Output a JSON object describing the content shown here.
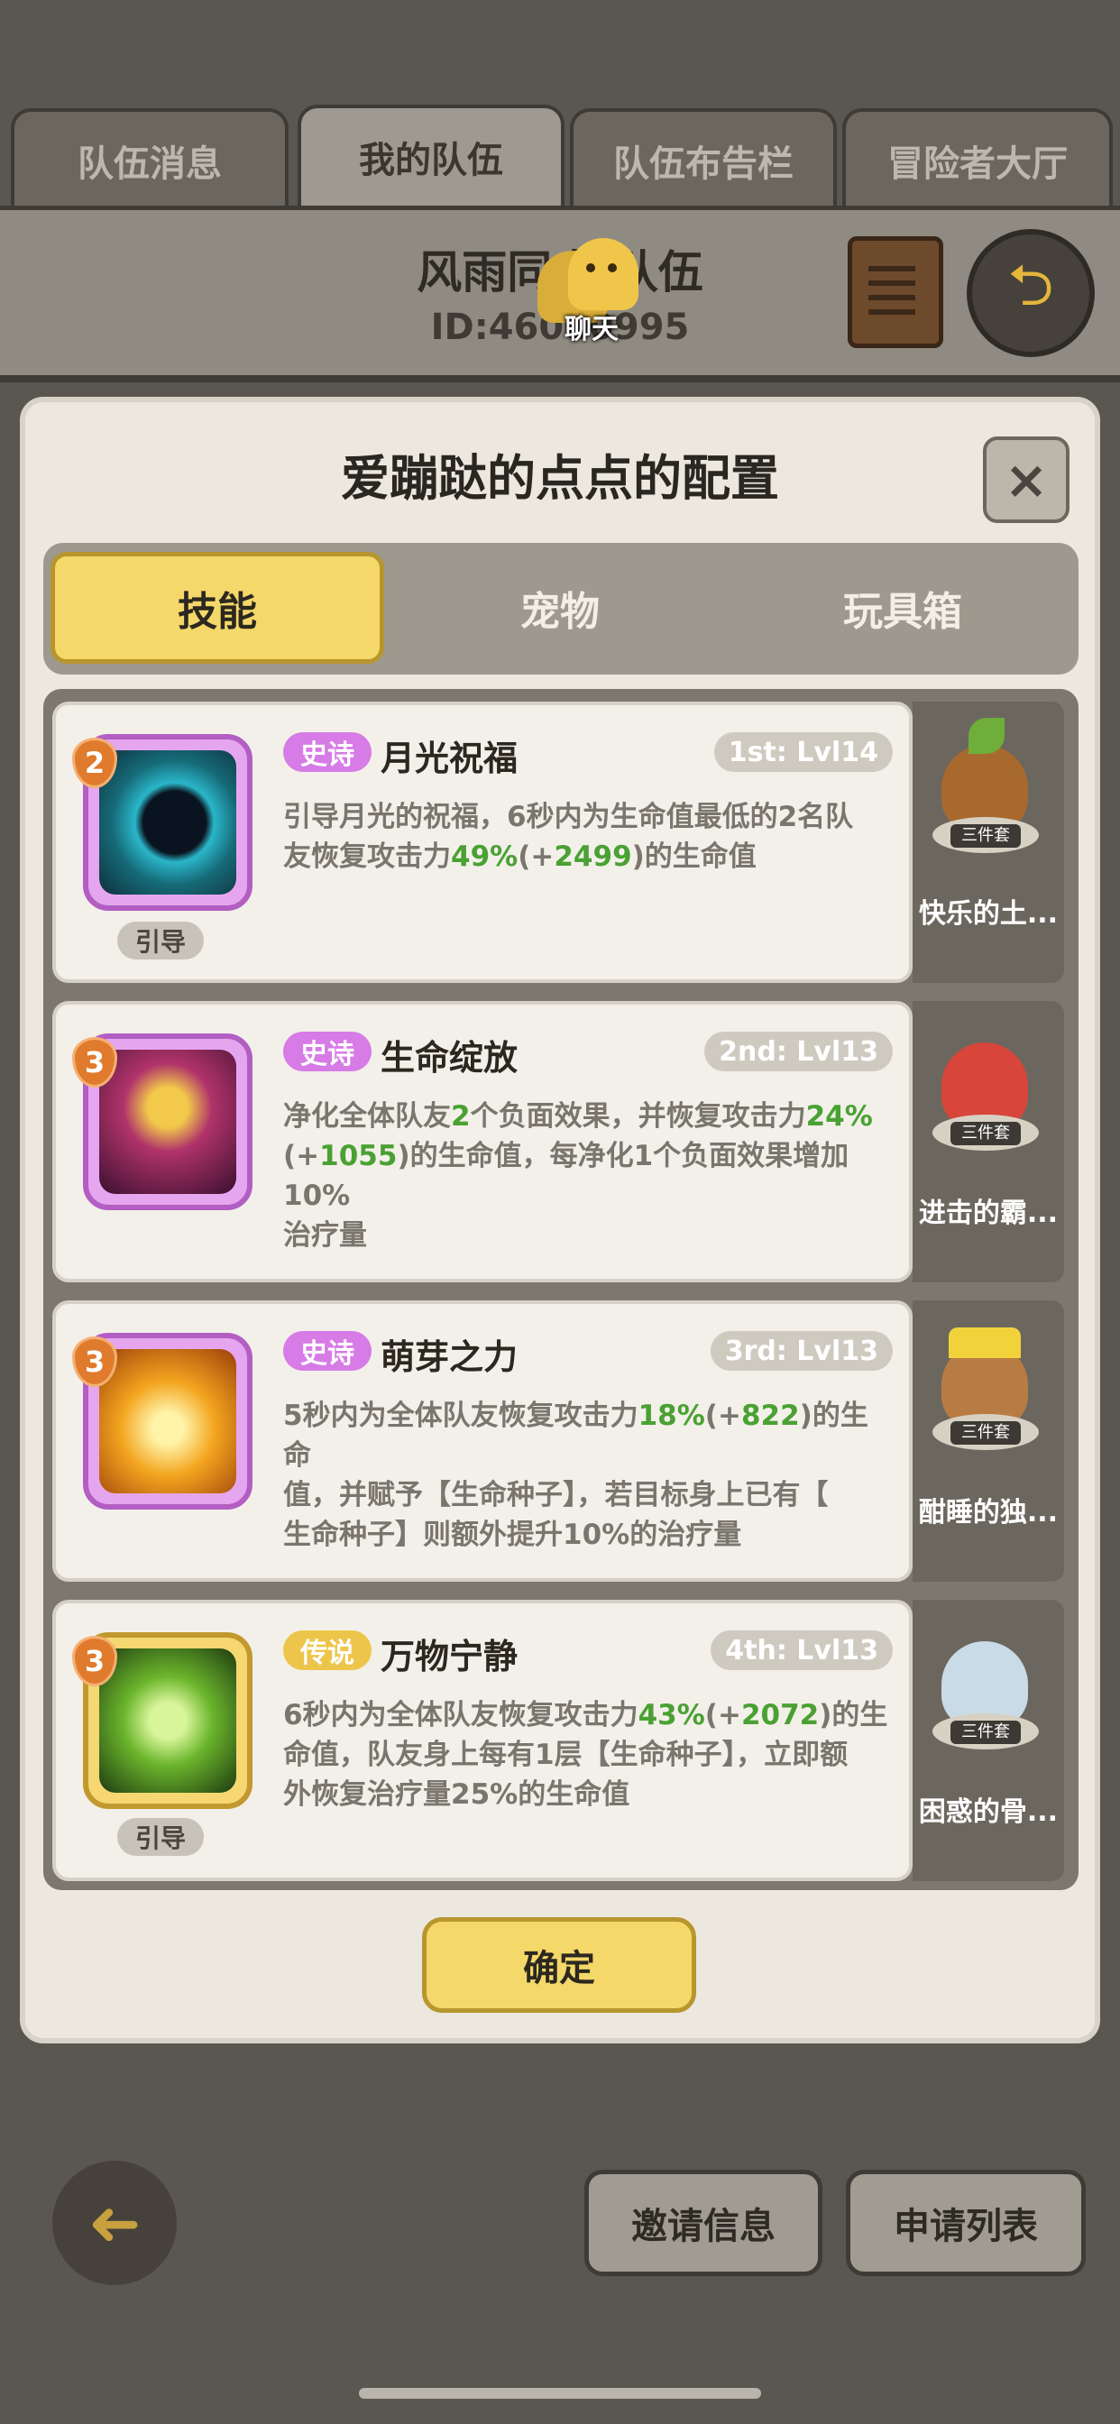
{
  "top_tabs": [
    "队伍消息",
    "我的队伍",
    "队伍布告栏",
    "冒险者大厅"
  ],
  "team": {
    "name": "风雨同舟 队伍",
    "id": "ID:46000995",
    "chat_label": "聊天"
  },
  "dialog": {
    "title": "爱蹦跶的点点的配置",
    "close_icon": "×",
    "tabs": [
      "技能",
      "宠物",
      "玩具箱"
    ],
    "confirm": "确定"
  },
  "skills": [
    {
      "level": "2",
      "rarity": "史诗",
      "name": "月光祝福",
      "rank": "1st: Lvl14",
      "guide": "引导",
      "desc": [
        "引导月光的祝福，6秒内为生命值最低的2名队",
        "友恢复攻击力",
        "49%",
        "(+",
        "2499",
        ")的生命值"
      ],
      "pet": "快乐的土...",
      "pet_tag": "三件套"
    },
    {
      "level": "3",
      "rarity": "史诗",
      "name": "生命绽放",
      "rank": "2nd: Lvl13",
      "guide": "",
      "desc": [
        "净化全体队友",
        "2",
        "个负面效果，并恢复攻击力",
        "24%",
        "(+",
        "1055",
        ")的生命值，每净化1个负面效果增加10%",
        "治疗量"
      ],
      "pet": "进击的霸...",
      "pet_tag": "三件套"
    },
    {
      "level": "3",
      "rarity": "史诗",
      "name": "萌芽之力",
      "rank": "3rd: Lvl13",
      "guide": "",
      "desc": [
        "5秒内为全体队友恢复攻击力",
        "18%",
        "(+",
        "822",
        ")的生命",
        "值，并赋予【生命种子】，若目标身上已有【",
        "生命种子】则额外提升10%的治疗量"
      ],
      "pet": "酣睡的独...",
      "pet_tag": "三件套"
    },
    {
      "level": "3",
      "rarity": "传说",
      "name": "万物宁静",
      "rank": "4th: Lvl13",
      "guide": "引导",
      "desc": [
        "6秒内为全体队友恢复攻击力",
        "43%",
        "(+",
        "2072",
        ")的生",
        "命值，队友身上每有1层【生命种子】，立即额",
        "外恢复治疗量25%的生命值"
      ],
      "pet": "困惑的骨...",
      "pet_tag": "三件套"
    }
  ],
  "bottom": {
    "invite": "邀请信息",
    "apply": "申请列表",
    "back_icon": "arrow-left-icon"
  },
  "colors": {
    "accent_yellow": "#f4d86a",
    "epic": "#d77be6",
    "legend": "#edc54a",
    "value_green": "#4aa133"
  }
}
